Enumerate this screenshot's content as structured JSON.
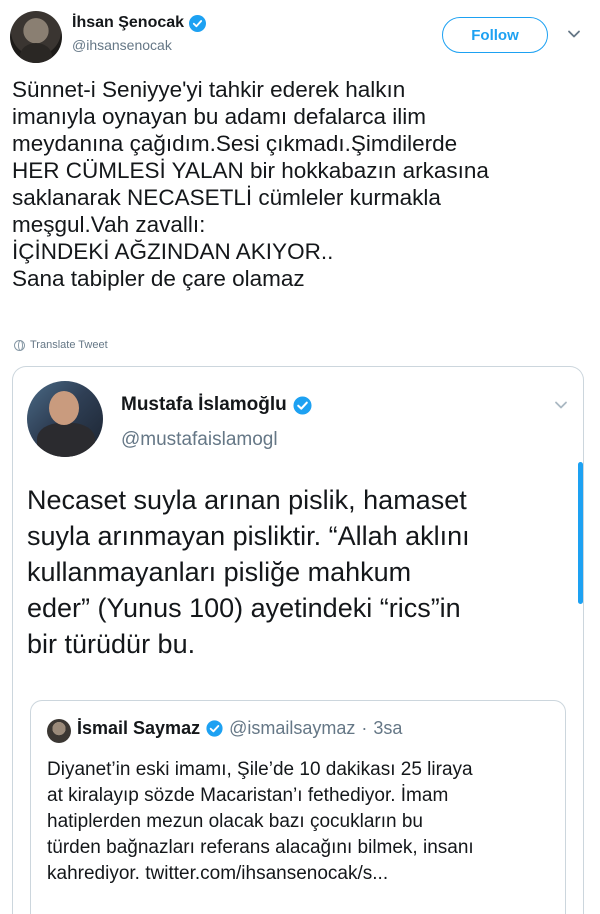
{
  "tweet": {
    "author": {
      "display_name": "İhsan Şenocak",
      "handle": "@ihsansenocak",
      "verified": true
    },
    "follow_label": "Follow",
    "text_lines": [
      "Sünnet-i Seniyye'yi tahkir ederek halkın",
      "imanıyla oynayan bu adamı defalarca ilim",
      "meydanına çağıdım.Sesi çıkmadı.Şimdilerde",
      "HER CÜMLESİ YALAN bir hokkabazın arkasına",
      "saklanarak NECASETLİ cümleler kurmakla",
      "meşgul.Vah zavallı:",
      "İÇİNDEKİ AĞZINDAN AKIYOR..",
      "Sana tabipler de çare olamaz"
    ],
    "translate_label": "Translate Tweet"
  },
  "quoted": {
    "author": {
      "display_name": "Mustafa İslamoğlu",
      "handle": "@mustafaislamogl",
      "verified": true
    },
    "text_lines": [
      "Necaset suyla arınan pislik, hamaset",
      "suyla arınmayan pisliktir. “Allah aklını",
      "kullanmayanları pisliğe mahkum",
      "eder” (Yunus 100) ayetindeki “rics”in",
      "bir türüdür bu."
    ],
    "inner_quote": {
      "author": {
        "display_name": "İsmail Saymaz",
        "handle": "@ismailsaymaz",
        "verified": true
      },
      "separator": "·",
      "time": "3sa",
      "text_lines": [
        "Diyanet’in eski imamı, Şile’de 10 dakikası 25 liraya",
        "at kiralayıp sözde Macaristan’ı fethediyor. İmam",
        "hatiplerden mezun olacak bazı çocukların bu",
        "türden bağnazları referans alacağını bilmek, insanı",
        "kahrediyor. twitter.com/ihsansenocak/s..."
      ]
    }
  },
  "colors": {
    "accent": "#1da1f2",
    "text": "#14171a",
    "muted": "#657786",
    "border": "#ccd6dd"
  },
  "icons": [
    "verified-badge-icon",
    "chevron-down-icon",
    "globe-icon"
  ]
}
